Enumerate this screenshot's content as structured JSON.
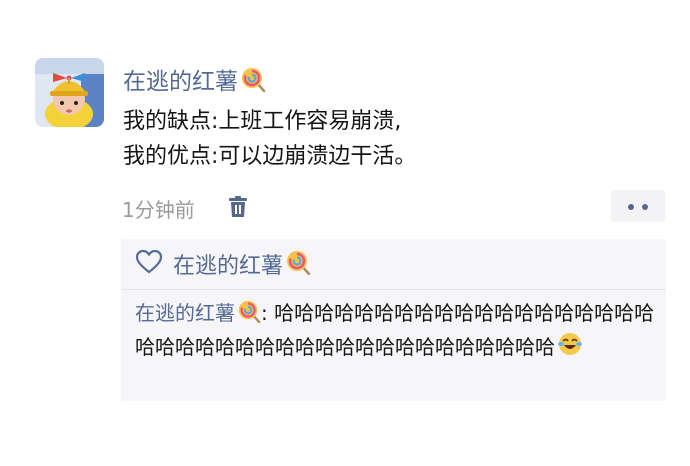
{
  "post": {
    "author": "在逃的红薯",
    "lines": [
      "我的缺点:上班工作容易崩溃,",
      "我的优点:可以边崩溃边干活。"
    ],
    "time": "1分钟前"
  },
  "likes": {
    "names": "在逃的红薯"
  },
  "comment": {
    "author": "在逃的红薯",
    "separator": ": ",
    "text": "哈哈哈哈哈哈哈哈哈哈哈哈哈哈哈哈哈哈哈哈哈哈哈哈哈哈哈哈哈哈哈哈哈哈哈哈哈哈哈哈"
  },
  "icons": {
    "author_emoji": "lollipop-icon",
    "like": "heart-outline-icon",
    "delete": "trash-icon",
    "more": "more-dots-icon",
    "comment_emoji": "laughing-tears-icon"
  },
  "colors": {
    "name_blue": "#556b95",
    "meta_gray": "#9b9b9b",
    "comment_bg": "#f6f6f8"
  }
}
